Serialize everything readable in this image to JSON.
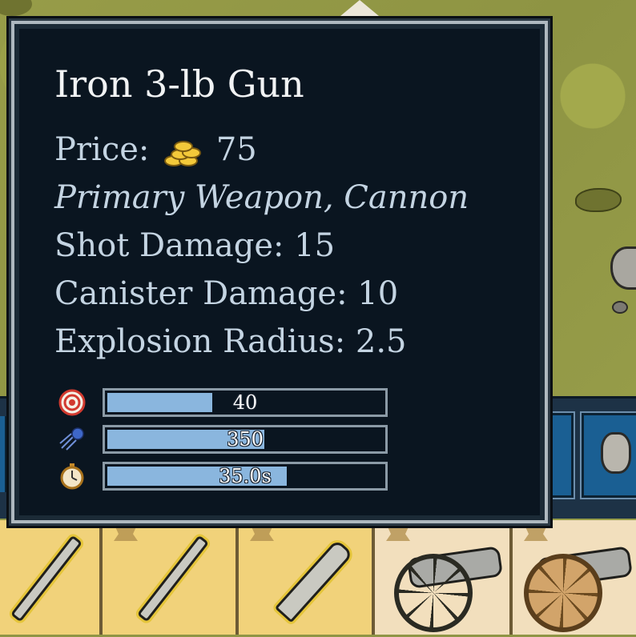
{
  "tooltip": {
    "title": "Iron 3-lb Gun",
    "price_label": "Price:",
    "price_value": "75",
    "price_icon": "gold-coins-icon",
    "category": "Primary Weapon, Cannon",
    "shot_damage": "Shot Damage: 15",
    "canister_damage": "Canister Damage: 10",
    "explosion_radius": "Explosion Radius: 2.5",
    "stats": [
      {
        "icon": "target-icon",
        "label": "40",
        "fill": 0.38
      },
      {
        "icon": "projectile-speed-icon",
        "label": "350",
        "fill": 0.57
      },
      {
        "icon": "stopwatch-icon",
        "label": "35.0s",
        "fill": 0.65
      }
    ]
  },
  "colors": {
    "tooltip_bg": "#0a1520",
    "text": "#c4d4e2",
    "bar_fill": "#8ab6de",
    "card_gold": "#f1d27a",
    "card_tan": "#f2dfbd",
    "slot_button": "#1a5f93"
  },
  "cards": [
    {
      "icon": "bayonet-icon",
      "style": "gold"
    },
    {
      "icon": "bayonet-icon",
      "style": "gold"
    },
    {
      "icon": "knife-icon",
      "style": "gold"
    },
    {
      "icon": "cannon-icon",
      "style": "tan"
    },
    {
      "icon": "cannon-icon",
      "style": "tan"
    }
  ]
}
